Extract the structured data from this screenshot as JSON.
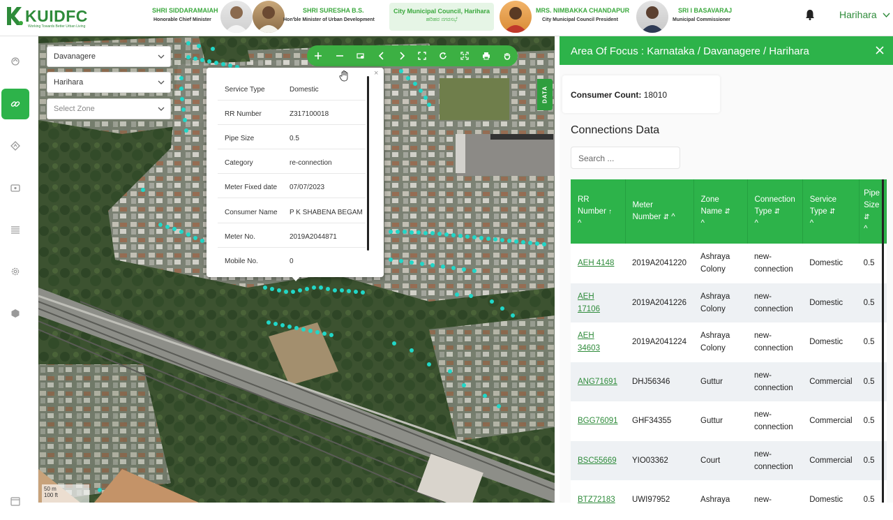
{
  "header": {
    "logo_text": "KUIDFC",
    "logo_tagline": "Working Towards Better Urban Living",
    "officials": [
      {
        "name": "SHRI SIDDARAMAIAH",
        "role": "Honorable Chief Minister"
      },
      {
        "name": "SHRI SURESHA B.S.",
        "role": "Hon'ble Minister of Urban Development"
      },
      {
        "name": "MRS. NIMBAKKA CHANDAPUR",
        "role": "City Municipal Council President"
      },
      {
        "name": "SRI I BASAVARAJ",
        "role": "Municipal Commissioner"
      }
    ],
    "council": {
      "title": "City Municipal Council, Harihara",
      "subtitle": "ಹರಿಹರ ನಗರಸಭೆ"
    },
    "user": "Harihara",
    "colors": {
      "primary": "#2db34a",
      "brand": "#2e8b3a"
    }
  },
  "map": {
    "filters": [
      {
        "value": "Davanagere"
      },
      {
        "value": "Harihara"
      },
      {
        "value": "Select Zone"
      }
    ],
    "data_tab": "DATA",
    "scale": [
      "50 m",
      "100 ft"
    ],
    "popup": {
      "rows": [
        {
          "label": "Service Type",
          "value": "Domestic"
        },
        {
          "label": "RR Number",
          "value": "Z317100018"
        },
        {
          "label": "Pipe Size",
          "value": "0.5"
        },
        {
          "label": "Category",
          "value": "re-connection"
        },
        {
          "label": "Meter Fixed date",
          "value": "07/07/2023"
        },
        {
          "label": "Consumer Name",
          "value": "P K SHABENA BEGAM"
        },
        {
          "label": "Meter No.",
          "value": "2019A2044871"
        },
        {
          "label": "Mobile No.",
          "value": "0"
        }
      ],
      "close": "×"
    }
  },
  "panel": {
    "title": "Area Of Focus : Karnataka / Davanagere / Harihara",
    "consumer_count_label": "Consumer Count:",
    "consumer_count": "18010",
    "section_title": "Connections Data",
    "search_placeholder": "Search ...",
    "columns": [
      {
        "l1": "RR",
        "l2": "Number",
        "sort": "↑",
        "chev": "^"
      },
      {
        "l1": "Meter",
        "l2": "Number",
        "sort": "⇵",
        "chev": "^"
      },
      {
        "l1": "Zone",
        "l2": "Name",
        "sort": "⇵",
        "chev": "^"
      },
      {
        "l1": "Connection",
        "l2": "Type",
        "sort": "⇵",
        "chev": "^"
      },
      {
        "l1": "Service",
        "l2": "Type",
        "sort": "⇵",
        "chev": "^"
      },
      {
        "l1": "Pipe",
        "l2": "Size",
        "sort": "⇵",
        "chev": "^"
      }
    ],
    "rows": [
      [
        "AEH 4148",
        "2019A2041220",
        "Ashraya Colony",
        "new-connection",
        "Domestic",
        "0.5"
      ],
      [
        "AEH 17106",
        "2019A2041226",
        "Ashraya Colony",
        "new-connection",
        "Domestic",
        "0.5"
      ],
      [
        "AEH 34603",
        "2019A2041224",
        "Ashraya Colony",
        "new-connection",
        "Domestic",
        "0.5"
      ],
      [
        "ANG71691",
        "DHJ56346",
        "Guttur",
        "new-connection",
        "Commercial",
        "0.5"
      ],
      [
        "BGG76091",
        "GHF34355",
        "Guttur",
        "new-connection",
        "Commercial",
        "0.5"
      ],
      [
        "BSC55669",
        "YIO03362",
        "Court",
        "new-connection",
        "Commercial",
        "0.5"
      ],
      [
        "BTZ72183",
        "UWI97952",
        "Ashraya",
        "new-",
        "Domestic",
        "0.5"
      ]
    ]
  }
}
